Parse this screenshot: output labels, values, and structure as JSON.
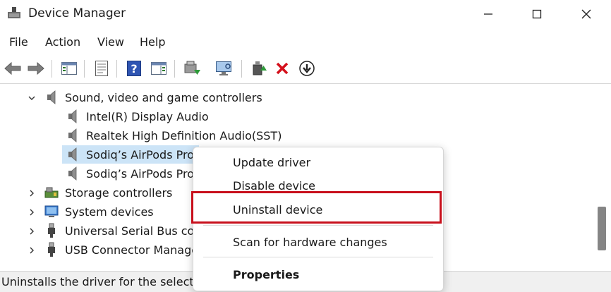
{
  "window": {
    "title": "Device Manager"
  },
  "menu": {
    "items": [
      "File",
      "Action",
      "View",
      "Help"
    ]
  },
  "toolbar": {
    "icons": [
      "back-arrow-icon",
      "forward-arrow-icon",
      "show-hide-tree-icon",
      "properties-icon",
      "help-icon",
      "action-pane-icon",
      "update-driver-icon",
      "scan-hardware-icon",
      "enable-device-icon",
      "uninstall-icon",
      "download-driver-icon"
    ]
  },
  "tree": {
    "category_sound": "Sound, video and game controllers",
    "sound_children": [
      "Intel(R) Display Audio",
      "Realtek High Definition Audio(SST)",
      "Sodiq’s AirPods Pro",
      "Sodiq’s AirPods Pro"
    ],
    "categories": [
      "Storage controllers",
      "System devices",
      "Universal Serial Bus controllers",
      "USB Connector Managers"
    ]
  },
  "context_menu": {
    "update": "Update driver",
    "disable": "Disable device",
    "uninstall": "Uninstall device",
    "scan": "Scan for hardware changes",
    "properties": "Properties"
  },
  "status": {
    "text": "Uninstalls the driver for the selected device."
  },
  "colors": {
    "highlight_border": "#c8101c",
    "selection": "#cce4f7"
  }
}
